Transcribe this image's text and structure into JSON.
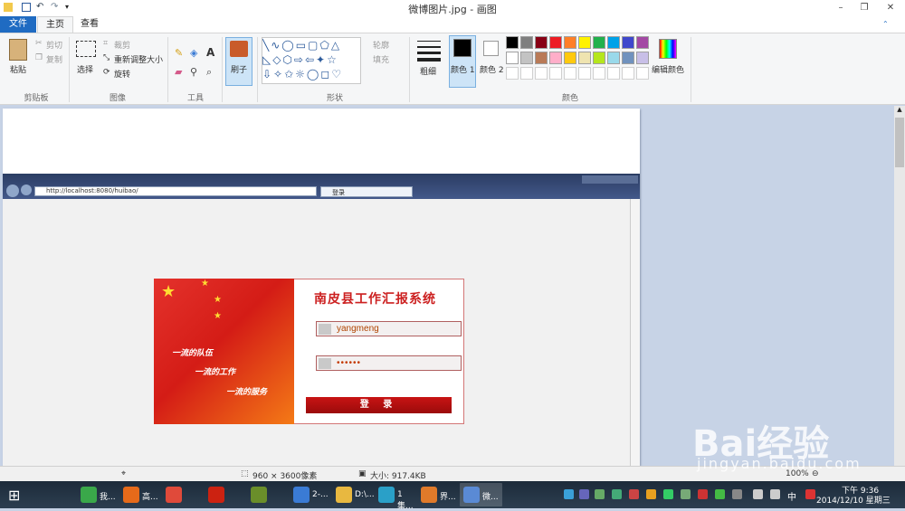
{
  "window": {
    "title": "微博图片.jpg - 画图",
    "min": "–",
    "restore": "❐",
    "close": "✕"
  },
  "tabs": {
    "file": "文件",
    "home": "主页",
    "view": "查看"
  },
  "clipboard": {
    "paste": "粘贴",
    "cut": "剪切",
    "copy": "复制",
    "group": "剪贴板"
  },
  "image": {
    "select": "选择",
    "crop": "裁剪",
    "resize": "重新调整大小",
    "rotate": "旋转",
    "group": "图像"
  },
  "tools": {
    "group": "工具",
    "text_tool": "A"
  },
  "brushes": {
    "label": "刷子"
  },
  "shapes": {
    "outline": "轮廓",
    "fill": "填充",
    "group": "形状"
  },
  "size": {
    "label": "粗细"
  },
  "colors": {
    "color1": "颜色 1",
    "color2": "颜色 2",
    "edit": "编辑颜色",
    "group": "颜色",
    "row1": [
      "#000000",
      "#7f7f7f",
      "#880015",
      "#ed1c24",
      "#ff7f27",
      "#fff200",
      "#22b14c",
      "#00a2e8",
      "#3f48cc",
      "#a349a4"
    ],
    "row2": [
      "#ffffff",
      "#c3c3c3",
      "#b97a57",
      "#ffaec9",
      "#ffc90e",
      "#efe4b0",
      "#b5e61d",
      "#99d9ea",
      "#7092be",
      "#c8bfe7"
    ]
  },
  "browser": {
    "url": "http://localhost:8080/huibao/",
    "tab_title": "登录"
  },
  "login": {
    "title": "南皮县工作汇报系统",
    "slogan1": "一流的队伍",
    "slogan2": "一流的工作",
    "slogan3": "一流的服务",
    "username": "yangmeng",
    "password": "••••••",
    "button": "登 录"
  },
  "status": {
    "dims": "960 × 3600像素",
    "size": "大小: 917.4KB",
    "zoom": "100%"
  },
  "taskbar": {
    "items": [
      "我...",
      "高...",
      "",
      "",
      "",
      "2-...",
      "D:\\...",
      "1集...",
      "界...",
      "微..."
    ],
    "time": "下午 9:36",
    "date": "2014/12/10 星期三",
    "ime": "中"
  },
  "watermark": {
    "brand": "Bai经验",
    "url": "jingyan.baidu.com"
  }
}
